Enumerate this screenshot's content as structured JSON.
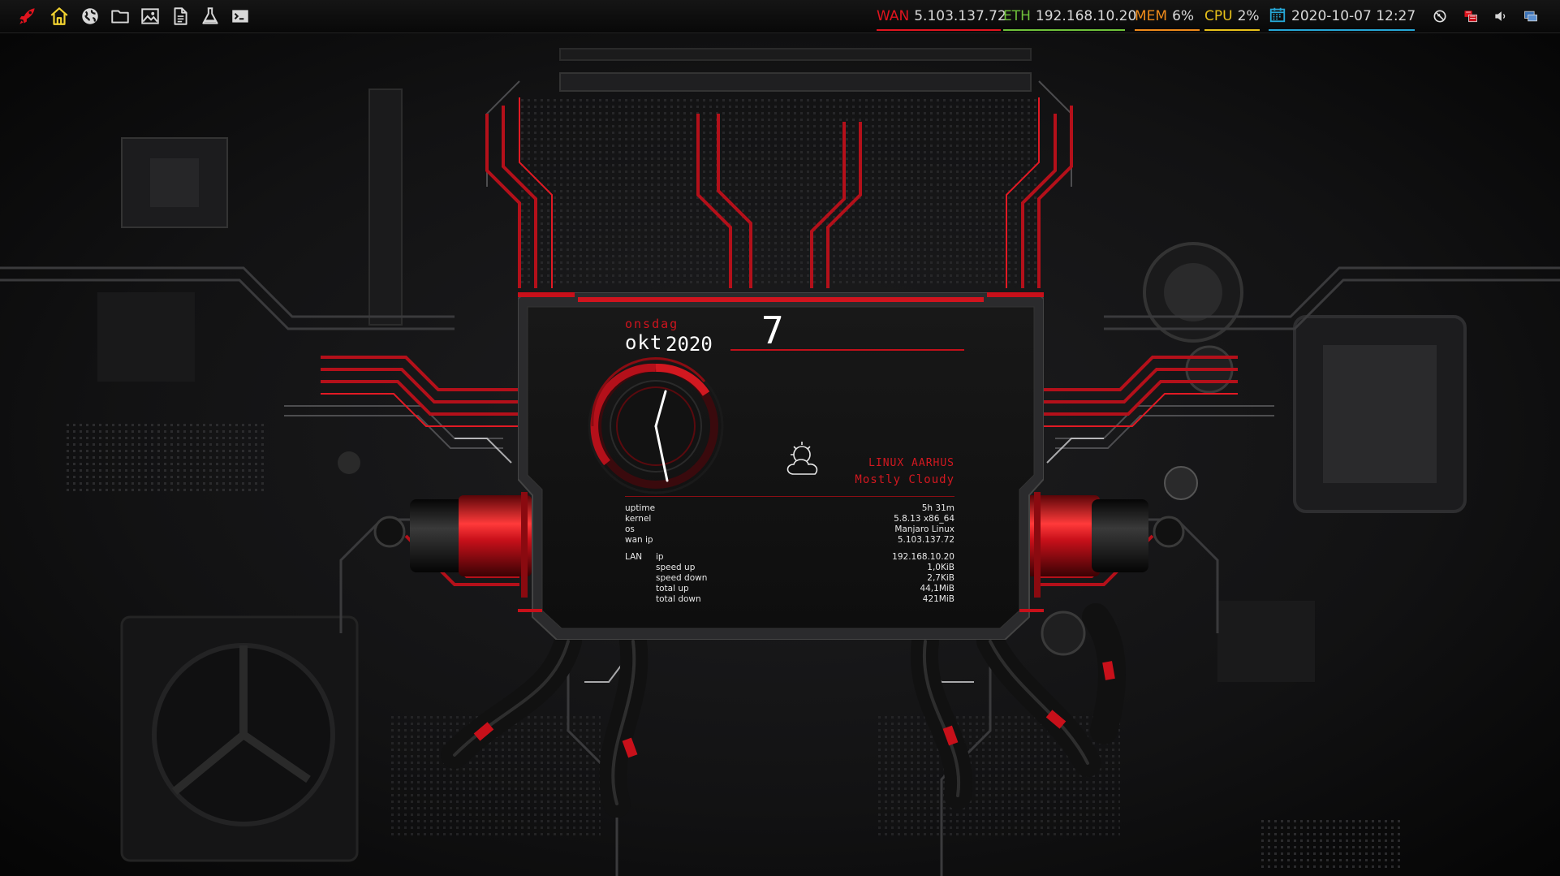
{
  "panel": {
    "launchers": [
      {
        "name": "rocket-launcher-icon",
        "color": "#e0141e"
      },
      {
        "name": "home-icon",
        "color": "#f2d230"
      },
      {
        "name": "globe-icon",
        "color": "#d8d8d8"
      },
      {
        "name": "folder-icon",
        "color": "#d8d8d8"
      },
      {
        "name": "image-icon",
        "color": "#d8d8d8"
      },
      {
        "name": "document-icon",
        "color": "#d8d8d8"
      },
      {
        "name": "flask-icon",
        "color": "#d8d8d8"
      },
      {
        "name": "terminal-icon",
        "color": "#d8d8d8"
      }
    ],
    "indicators": {
      "wan": {
        "label": "WAN",
        "value": "5.103.137.72",
        "color": "#e0141e"
      },
      "eth": {
        "label": "ETH",
        "value": "192.168.10.20",
        "color": "#6fc23a"
      },
      "mem": {
        "label": "MEM",
        "value": "6%",
        "color": "#ee8a1a"
      },
      "cpu": {
        "label": "CPU",
        "value": "2%",
        "color": "#e8c21a"
      },
      "datetime": {
        "value": "2020-10-07 12:27",
        "color": "#26a7d6"
      }
    },
    "tray": [
      "no-notifications-icon",
      "network-manager-icon",
      "volume-icon",
      "display-icon"
    ]
  },
  "conky": {
    "date": {
      "day_name": "onsdag",
      "month": "okt",
      "year": "2020",
      "day": "7"
    },
    "clock": {
      "hour_hand": "12",
      "minute_hand": "27"
    },
    "weather": {
      "location": "LINUX AARHUS",
      "condition": "Mostly Cloudy",
      "icon": "partly-cloudy-icon"
    },
    "system": {
      "uptime_label": "uptime",
      "uptime": "5h 31m",
      "kernel_label": "kernel",
      "kernel": "5.8.13 x86_64",
      "os_label": "os",
      "os": "Manjaro Linux",
      "wanip_label": "wan ip",
      "wanip": "5.103.137.72"
    },
    "lan": {
      "section": "LAN",
      "ip_label": "ip",
      "ip": "192.168.10.20",
      "speed_up_label": "speed up",
      "speed_up": "1,0KiB",
      "speed_down_label": "speed down",
      "speed_down": "2,7KiB",
      "total_up_label": "total up",
      "total_up": "44,1MiB",
      "total_down_label": "total down",
      "total_down": "421MiB"
    }
  }
}
